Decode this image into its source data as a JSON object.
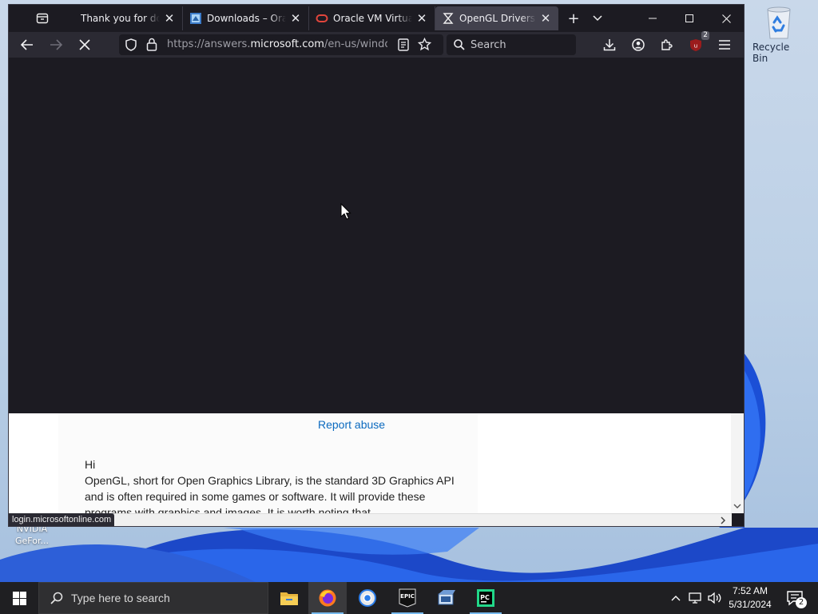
{
  "desktop": {
    "recycle_bin_label": "Recycle Bin",
    "nvidia_label_line1": "NVIDIA",
    "nvidia_label_line2": "GeFor..."
  },
  "browser": {
    "tabs": [
      {
        "title": "Thank you for downloading",
        "icon": "firefox-view-placeholder-icon"
      },
      {
        "title": "Downloads – Oracle",
        "icon": "oracle-downloads-favicon"
      },
      {
        "title": "Oracle VM VirtualBox",
        "icon": "oracle-ring-favicon"
      },
      {
        "title": "OpenGL Drivers - Microsoft",
        "icon": "loading-hourglass-icon",
        "active": true
      }
    ],
    "url_prefix": "https://answers.",
    "url_domain": "microsoft.com",
    "url_suffix": "/en-us/windows",
    "search_placeholder": "Search",
    "extension_badge": "2",
    "status_url": "login.microsoftonline.com"
  },
  "page": {
    "report_abuse": "Report abuse",
    "greeting": "Hi",
    "body_text": "OpenGL, short for Open Graphics Library, is the standard 3D Graphics API and is often required in some games or software. It will provide these programs with graphics and images. It is worth noting that"
  },
  "taskbar": {
    "search_placeholder": "Type here to search",
    "time": "7:52 AM",
    "date": "5/31/2024",
    "notification_count": "2"
  },
  "colors": {
    "accent_blue": "#0b6abf",
    "browser_dark": "#1c1b22",
    "toolbar": "#2b2a33",
    "taskbar": "#1f1f22"
  }
}
